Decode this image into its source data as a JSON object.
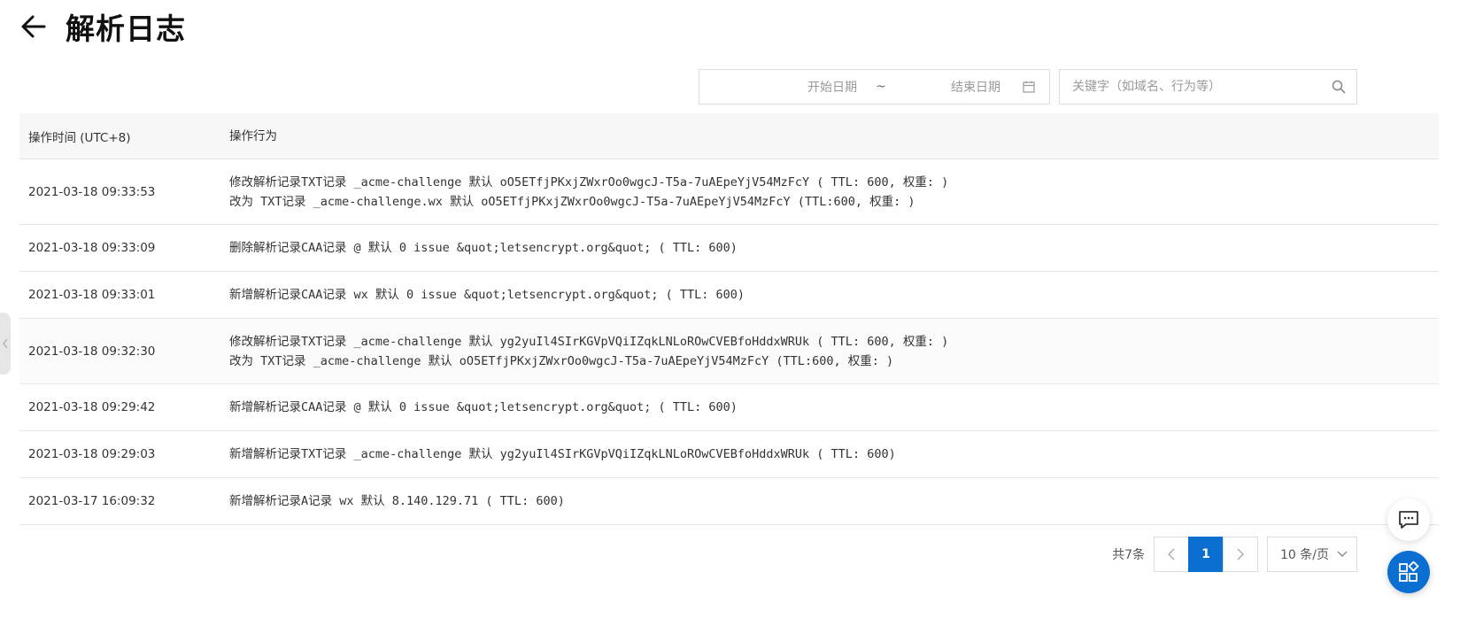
{
  "page": {
    "title": "解析日志"
  },
  "filters": {
    "start_date_placeholder": "开始日期",
    "separator": "~",
    "end_date_placeholder": "结束日期",
    "search_placeholder": "关键字（如域名、行为等）"
  },
  "table": {
    "columns": [
      "操作时间 (UTC+8)",
      "操作行为"
    ],
    "rows": [
      {
        "time": "2021-03-18 09:33:53",
        "lines": [
          "修改解析记录TXT记录 _acme-challenge 默认 oO5ETfjPKxjZWxrOo0wgcJ-T5a-7uAEpeYjV54MzFcY ( TTL: 600, 权重: )",
          "改为 TXT记录 _acme-challenge.wx 默认 oO5ETfjPKxjZWxrOo0wgcJ-T5a-7uAEpeYjV54MzFcY (TTL:600, 权重: )"
        ]
      },
      {
        "time": "2021-03-18 09:33:09",
        "lines": [
          "删除解析记录CAA记录 @ 默认 0 issue &quot;letsencrypt.org&quot; ( TTL: 600)"
        ]
      },
      {
        "time": "2021-03-18 09:33:01",
        "lines": [
          "新增解析记录CAA记录 wx 默认 0 issue &quot;letsencrypt.org&quot; ( TTL: 600)"
        ]
      },
      {
        "time": "2021-03-18 09:32:30",
        "lines": [
          "修改解析记录TXT记录 _acme-challenge 默认 yg2yuIl4SIrKGVpVQiIZqkLNLoROwCVEBfoHddxWRUk ( TTL: 600, 权重: )",
          "改为 TXT记录 _acme-challenge 默认 oO5ETfjPKxjZWxrOo0wgcJ-T5a-7uAEpeYjV54MzFcY (TTL:600, 权重: )"
        ]
      },
      {
        "time": "2021-03-18 09:29:42",
        "lines": [
          "新增解析记录CAA记录 @ 默认 0 issue &quot;letsencrypt.org&quot; ( TTL: 600)"
        ]
      },
      {
        "time": "2021-03-18 09:29:03",
        "lines": [
          "新增解析记录TXT记录 _acme-challenge 默认 yg2yuIl4SIrKGVpVQiIZqkLNLoROwCVEBfoHddxWRUk ( TTL: 600)"
        ]
      },
      {
        "time": "2021-03-17 16:09:32",
        "lines": [
          "新增解析记录A记录 wx 默认 8.140.129.71 ( TTL: 600)"
        ]
      }
    ]
  },
  "pagination": {
    "total": "共7条",
    "prev": "<",
    "current": "1",
    "next": ">",
    "page_size": "10 条/页"
  },
  "icons": {
    "back": "arrow-left-icon",
    "calendar": "calendar-icon",
    "search": "search-icon",
    "chat": "chat-icon",
    "apps": "apps-icon",
    "side": "chevron-left-icon"
  },
  "colors": {
    "primary": "#0a6fd1",
    "header_bg": "#f7f7f7"
  }
}
